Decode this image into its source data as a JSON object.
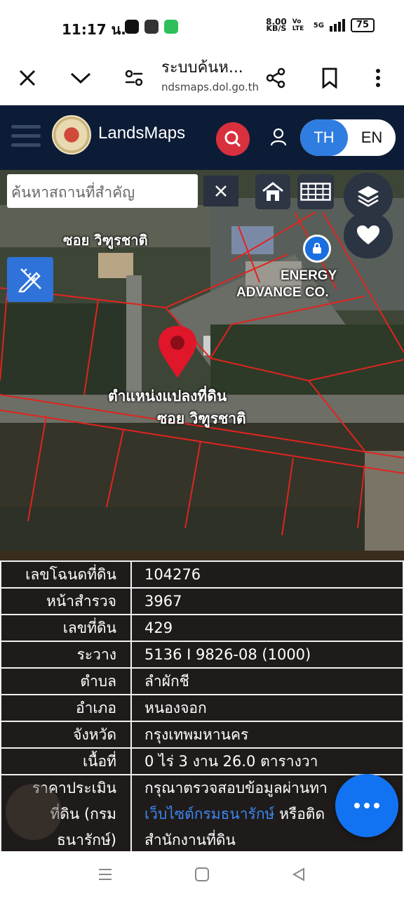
{
  "status_bar": {
    "time": "11:17 น.",
    "speed_value": "8.00",
    "speed_unit": "KB/S",
    "network_a": "Vo LTE",
    "network_b": "5G",
    "battery": "75"
  },
  "browser": {
    "page_title": "ระบบค้นห...",
    "url": "ndsmaps.dol.go.th"
  },
  "app": {
    "brand": "LandsMaps",
    "lang_th": "TH",
    "lang_en": "EN"
  },
  "map": {
    "search_placeholder": "ค้นหาสถานที่สำคัญ",
    "road_label_top": "ซอย วิฑูรชาติ",
    "road_label_bottom": "ซอย วิฑูรชาติ",
    "poi_label_line1": "ENERGY",
    "poi_label_line2": "ADVANCE CO.",
    "pin_label": "ตำแหน่งแปลงที่ดิน"
  },
  "info": {
    "rows": [
      {
        "label": "เลขโฉนดที่ดิน",
        "value": "104276"
      },
      {
        "label": "หน้าสำรวจ",
        "value": "3967"
      },
      {
        "label": "เลขที่ดิน",
        "value": "429"
      },
      {
        "label": "ระวาง",
        "value": "5136 I 9826-08 (1000)"
      },
      {
        "label": "ตำบล",
        "value": "ลำผักชี"
      },
      {
        "label": "อำเภอ",
        "value": "หนองจอก"
      },
      {
        "label": "จังหวัด",
        "value": "กรุงเทพมหานคร"
      },
      {
        "label": "เนื้อที่",
        "value": "0 ไร่ 3 งาน 26.0 ตารางวา"
      }
    ],
    "price_label_1": "ราคาประเมิน",
    "price_label_2": "ที่ดิน (กรม",
    "price_label_3": "ธนารักษ์)",
    "price_value_1": "กรุณาตรวจสอบข้อมูลผ่านทา",
    "price_link": "เว็บไซต์กรมธนารักษ์",
    "price_value_2_suffix": " หรือติด",
    "price_value_3": "สำนักงานที่ดิน"
  },
  "colors": {
    "header_bg": "#0d1c36",
    "accent_blue": "#2f7de1",
    "search_red": "#d9303e",
    "parcel_line": "#e0241f"
  }
}
